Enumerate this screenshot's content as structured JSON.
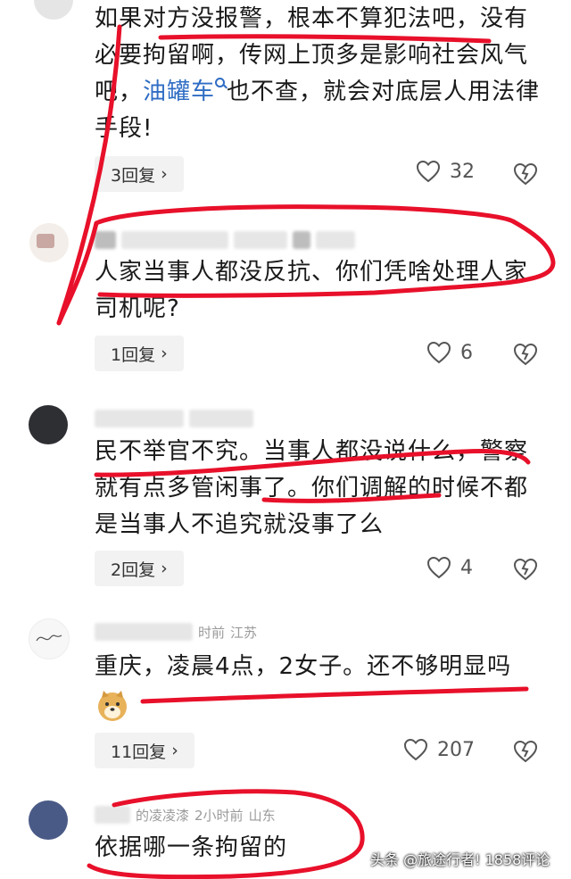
{
  "comments": [
    {
      "text_pre": "如果对方没报警，根本不算犯法吧，没有必要拘留啊，传网上顶多是影响社会风气吧，",
      "link": "油罐车",
      "text_post": "也不查，就会对底层人用法律手段!",
      "replies": "3回复",
      "likes": "32"
    },
    {
      "text": "人家当事人都没反抗、你们凭啥处理人家司机呢?",
      "replies": "1回复",
      "likes": "6"
    },
    {
      "text": "民不举官不究。当事人都没说什么，警察就有点多管闲事了。你们调解的时候不都是当事人不追究就没事了么",
      "replies": "2回复",
      "likes": "4"
    },
    {
      "meta_location": "江苏",
      "meta_time_suffix": "时前",
      "text": "重庆，凌晨4点，2女子。还不够明显吗",
      "replies": "11回复",
      "likes": "207"
    },
    {
      "meta_user_tail": "的凌凌漆",
      "meta_time": "2小时前",
      "meta_location": "山东",
      "text": "依据哪一条拘留的"
    }
  ],
  "watermark": "头条 @旅途行者! 1858评论",
  "colors": {
    "annotation": "#e8102a",
    "link": "#2f6dc4",
    "reply_bg": "#f2f2f2"
  },
  "icons": [
    "heart-icon",
    "dislike-heart-icon",
    "search-icon",
    "chevron-right-icon",
    "doge-emoji-icon"
  ]
}
